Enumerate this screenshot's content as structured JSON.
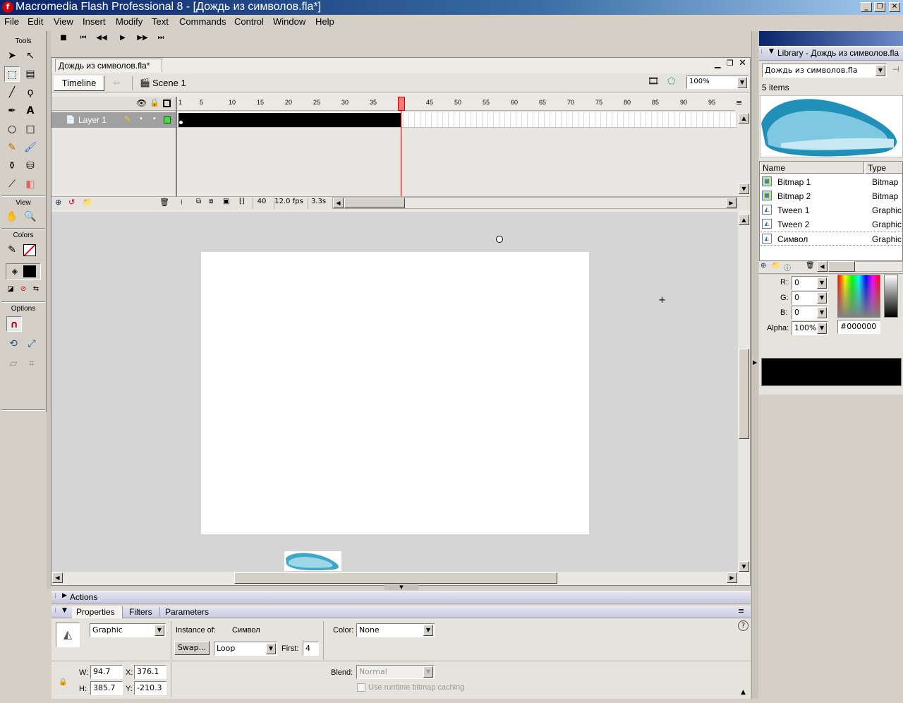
{
  "window": {
    "title": "Macromedia Flash Professional 8 - [Дождь из символов.fla*]",
    "min_label": "_",
    "restore_label": "❐",
    "close_label": "✕"
  },
  "menu": [
    "File",
    "Edit",
    "View",
    "Insert",
    "Modify",
    "Text",
    "Commands",
    "Control",
    "Window",
    "Help"
  ],
  "controller": [
    "■",
    "⏮",
    "◀◀",
    "▶",
    "▶▶",
    "⏭"
  ],
  "tools": {
    "title": "Tools",
    "view_label": "View",
    "colors_label": "Colors",
    "options_label": "Options"
  },
  "document": {
    "tab_title": "Дождь из символов.fla*",
    "timeline_button": "Timeline",
    "scene_label": "Scene 1",
    "zoom": "100%"
  },
  "timeline": {
    "layer_name": "Layer 1",
    "ruler_ticks": [
      "1",
      "5",
      "10",
      "15",
      "20",
      "25",
      "30",
      "35",
      "40",
      "45",
      "50",
      "55",
      "60",
      "65",
      "70",
      "75",
      "80",
      "85",
      "90",
      "95"
    ],
    "current_frame": "40",
    "fps": "12.0 fps",
    "elapsed": "3.3s"
  },
  "panels": {
    "actions_label": "Actions",
    "properties_tab": "Properties",
    "filters_tab": "Filters",
    "parameters_tab": "Parameters"
  },
  "properties": {
    "symbol_behavior": "Graphic",
    "instance_of_label": "Instance of:",
    "instance_of_value": "Символ",
    "swap_button": "Swap...",
    "loop_value": "Loop",
    "first_label": "First:",
    "first_value": "4",
    "color_label": "Color:",
    "color_value": "None",
    "w_label": "W:",
    "w_value": "94.7",
    "h_label": "H:",
    "h_value": "385.7",
    "x_label": "X:",
    "x_value": "376.1",
    "y_label": "Y:",
    "y_value": "-210.3",
    "blend_label": "Blend:",
    "blend_value": "Normal",
    "cache_label": "Use runtime bitmap caching",
    "help_icon": "?"
  },
  "library": {
    "title": "Library - Дождь из символов.fla",
    "document_select": "Дождь из символов.fla",
    "items_count": "5 items",
    "col_name": "Name",
    "col_type": "Type",
    "items": [
      {
        "name": "Bitmap 1",
        "type": "Bitmap"
      },
      {
        "name": "Bitmap 2",
        "type": "Bitmap"
      },
      {
        "name": "Tween 1",
        "type": "Graphic"
      },
      {
        "name": "Tween 2",
        "type": "Graphic"
      },
      {
        "name": "Символ",
        "type": "Graphic"
      }
    ]
  },
  "color_mixer": {
    "r_label": "R:",
    "r_value": "0",
    "g_label": "G:",
    "g_value": "0",
    "b_label": "B:",
    "b_value": "0",
    "alpha_label": "Alpha:",
    "alpha_value": "100%",
    "hex_value": "#000000"
  }
}
